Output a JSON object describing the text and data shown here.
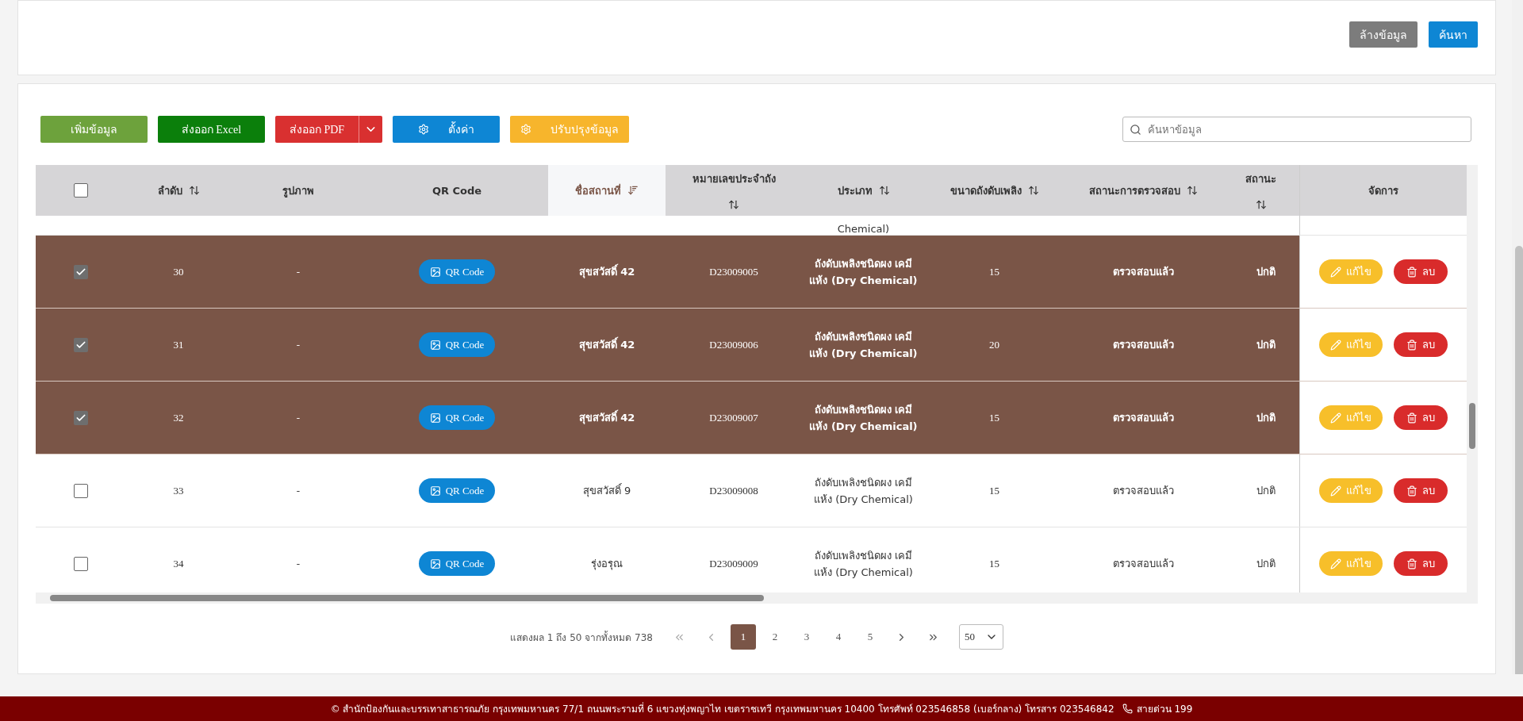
{
  "search_panel": {
    "buttons": [
      {
        "label": "ล้างข้อมูล",
        "kind": "secondary"
      },
      {
        "label": "ค้นหา",
        "kind": "primary"
      }
    ]
  },
  "toolbar": {
    "buttons": [
      {
        "label": "เพิ่มข้อมูล",
        "kind": "add"
      },
      {
        "label": "ส่งออก Excel",
        "kind": "excel"
      },
      {
        "label": "ส่งออก PDF",
        "kind": "pdf"
      },
      {
        "label": "ตั้งค่า",
        "kind": "settings"
      },
      {
        "label": "ปรับปรุงข้อมูล",
        "kind": "update"
      }
    ],
    "search": {
      "placeholder": "ค้นหาข้อมูล"
    }
  },
  "table": {
    "select_all": {
      "checked": false
    },
    "columns": [
      {
        "label": "ลำดับ",
        "sortable": true,
        "sorted": false
      },
      {
        "label": "รูปภาพ",
        "sortable": false,
        "sorted": false
      },
      {
        "label": "QR Code",
        "sortable": false,
        "sorted": false
      },
      {
        "label": "ชื่อสถานที่",
        "sortable": true,
        "sorted": true
      },
      {
        "label": "หมายเลขประจำถัง",
        "sortable": true,
        "sorted": false
      },
      {
        "label": "ประเภท",
        "sortable": true,
        "sorted": false
      },
      {
        "label": "ขนาดถังดับเพลิง",
        "sortable": true,
        "sorted": false
      },
      {
        "label": "สถานะการตรวจสอบ",
        "sortable": true,
        "sorted": false
      },
      {
        "label": "สถานะ",
        "sortable": true,
        "sorted": false
      },
      {
        "label": "จัดการ",
        "sortable": false,
        "sorted": false
      }
    ],
    "clipped_row": {
      "type": "Chemical)"
    },
    "rows": [
      {
        "checked": true,
        "selected": true,
        "seq": "30",
        "image": "-",
        "qr": "QR Code",
        "name": "สุขสวัสดิ์ 42",
        "number": "D23009005",
        "type": "ถังดับเพลิงชนิดผง เคมีแห้ง (Dry Chemical)",
        "size": "15",
        "inspection": "ตรวจสอบแล้ว",
        "status": "ปกติ",
        "edit": "แก้ไข",
        "delete": "ลบ"
      },
      {
        "checked": true,
        "selected": true,
        "seq": "31",
        "image": "-",
        "qr": "QR Code",
        "name": "สุขสวัสดิ์ 42",
        "number": "D23009006",
        "type": "ถังดับเพลิงชนิดผง เคมีแห้ง (Dry Chemical)",
        "size": "20",
        "inspection": "ตรวจสอบแล้ว",
        "status": "ปกติ",
        "edit": "แก้ไข",
        "delete": "ลบ"
      },
      {
        "checked": true,
        "selected": true,
        "seq": "32",
        "image": "-",
        "qr": "QR Code",
        "name": "สุขสวัสดิ์ 42",
        "number": "D23009007",
        "type": "ถังดับเพลิงชนิดผง เคมีแห้ง (Dry Chemical)",
        "size": "15",
        "inspection": "ตรวจสอบแล้ว",
        "status": "ปกติ",
        "edit": "แก้ไข",
        "delete": "ลบ"
      },
      {
        "checked": false,
        "selected": false,
        "seq": "33",
        "image": "-",
        "qr": "QR Code",
        "name": "สุขสวัสดิ์ 9",
        "number": "D23009008",
        "type": "ถังดับเพลิงชนิดผง เคมีแห้ง (Dry Chemical)",
        "size": "15",
        "inspection": "ตรวจสอบแล้ว",
        "status": "ปกติ",
        "edit": "แก้ไข",
        "delete": "ลบ"
      },
      {
        "checked": false,
        "selected": false,
        "seq": "34",
        "image": "-",
        "qr": "QR Code",
        "name": "รุ่งอรุณ",
        "number": "D23009009",
        "type": "ถังดับเพลิงชนิดผง เคมีแห้ง (Dry Chemical)",
        "size": "15",
        "inspection": "ตรวจสอบแล้ว",
        "status": "ปกติ",
        "edit": "แก้ไข",
        "delete": "ลบ"
      }
    ]
  },
  "pagination": {
    "info": "แสดงผล 1 ถึง 50 จากทั้งหมด 738",
    "nav": [
      {
        "kind": "first",
        "disabled": true
      },
      {
        "kind": "prev",
        "disabled": true
      }
    ],
    "pages": [
      {
        "label": "1",
        "selected": true
      },
      {
        "label": "2",
        "selected": false
      },
      {
        "label": "3",
        "selected": false
      },
      {
        "label": "4",
        "selected": false
      },
      {
        "label": "5",
        "selected": false
      }
    ],
    "nav_end": [
      {
        "kind": "next",
        "disabled": false
      },
      {
        "kind": "last",
        "disabled": false
      }
    ],
    "page_size": "50"
  },
  "footer": {
    "address": "© สำนักป้องกันและบรรเทาสาธารณภัย กรุงเทพมหานคร 77/1 ถนนพระรามที่ 6 แขวงทุ่งพญาไท เขตราชเทวี กรุงเทพมหานคร 10400 โทรศัพท์ 023546858 (เบอร์กลาง) โทรสาร 023546842",
    "hotline": "สายด่วน 199"
  }
}
